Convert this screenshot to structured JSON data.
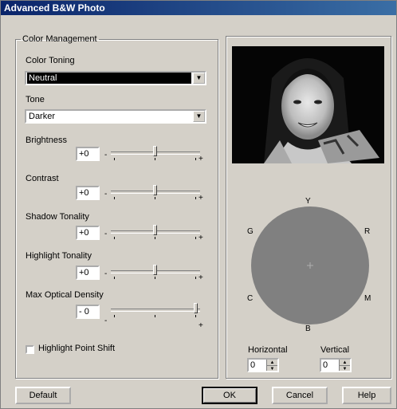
{
  "window": {
    "title": "Advanced B&W Photo"
  },
  "color_management": {
    "legend": "Color Management",
    "color_toning": {
      "label": "Color Toning",
      "value": "Neutral"
    },
    "tone": {
      "label": "Tone",
      "value": "Darker"
    },
    "sliders": [
      {
        "label": "Brightness",
        "value": "+0"
      },
      {
        "label": "Contrast",
        "value": "+0"
      },
      {
        "label": "Shadow Tonality",
        "value": "+0"
      },
      {
        "label": "Highlight Tonality",
        "value": "+0"
      },
      {
        "label": "Max Optical Density",
        "value": "- 0"
      }
    ],
    "slider_minus": "-",
    "slider_plus": "+",
    "highlight_shift": {
      "label": "Highlight Point Shift",
      "checked": false
    }
  },
  "color_wheel": {
    "labels": {
      "top": "Y",
      "bottom": "B",
      "upper_left": "G",
      "upper_right": "R",
      "lower_left": "C",
      "lower_right": "M"
    },
    "fill_color": "#808080",
    "horizontal": {
      "label": "Horizontal",
      "value": "0"
    },
    "vertical": {
      "label": "Vertical",
      "value": "0"
    }
  },
  "buttons": {
    "default": "Default",
    "ok": "OK",
    "cancel": "Cancel",
    "help": "Help"
  }
}
